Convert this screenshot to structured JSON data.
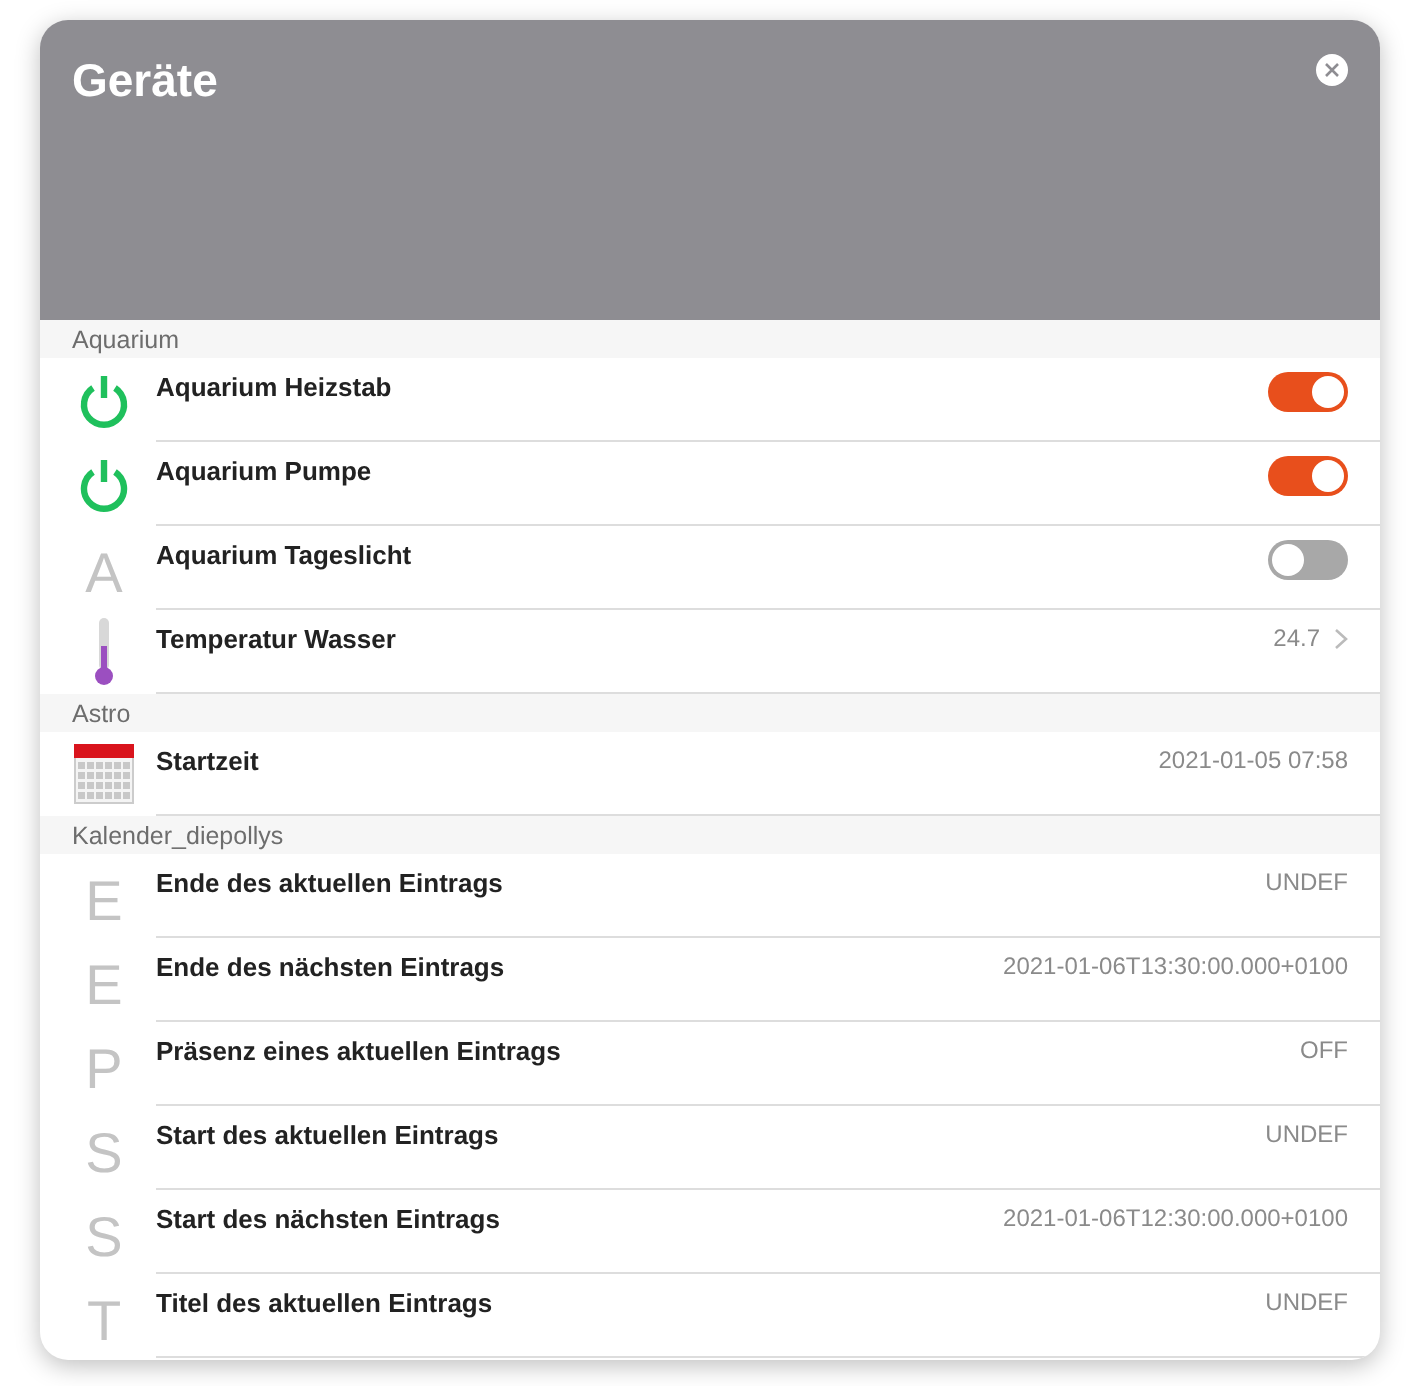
{
  "window": {
    "title": "Geräte"
  },
  "sections": [
    {
      "title": "Aquarium",
      "items": [
        {
          "kind": "power",
          "label": "Aquarium Heizstab",
          "on": true,
          "chevron": false
        },
        {
          "kind": "power",
          "label": "Aquarium Pumpe",
          "on": true,
          "chevron": false
        },
        {
          "kind": "letter",
          "letter": "A",
          "label": "Aquarium Tageslicht",
          "on": false,
          "chevron": false
        },
        {
          "kind": "thermometer",
          "label": "Temperatur Wasser",
          "value": "24.7",
          "chevron": true
        }
      ]
    },
    {
      "title": "Astro",
      "items": [
        {
          "kind": "calendar",
          "label": "Startzeit",
          "value": "2021-01-05 07:58",
          "chevron": false
        }
      ]
    },
    {
      "title": "Kalender_diepollys",
      "items": [
        {
          "kind": "letter",
          "letter": "E",
          "label": "Ende des aktuellen Eintrags",
          "value": "UNDEF",
          "chevron": false
        },
        {
          "kind": "letter",
          "letter": "E",
          "label": "Ende des nächsten Eintrags",
          "value": "2021-01-06T13:30:00.000+0100",
          "chevron": false
        },
        {
          "kind": "letter",
          "letter": "P",
          "label": "Präsenz eines aktuellen Eintrags",
          "value": "OFF",
          "chevron": false
        },
        {
          "kind": "letter",
          "letter": "S",
          "label": "Start des aktuellen Eintrags",
          "value": "UNDEF",
          "chevron": false
        },
        {
          "kind": "letter",
          "letter": "S",
          "label": "Start des nächsten Eintrags",
          "value": "2021-01-06T12:30:00.000+0100",
          "chevron": false
        },
        {
          "kind": "letter",
          "letter": "T",
          "label": "Titel des aktuellen Eintrags",
          "value": "UNDEF",
          "chevron": false
        }
      ]
    }
  ]
}
